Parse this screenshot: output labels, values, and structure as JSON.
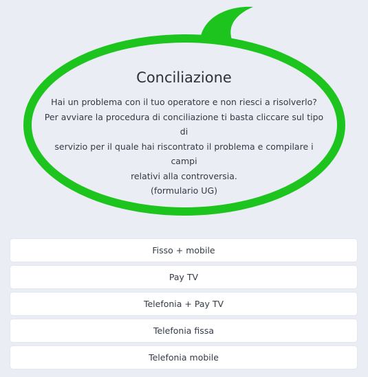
{
  "bubble": {
    "title": "Conciliazione",
    "lines": [
      "Hai un problema con il tuo operatore e non riesci a risolverlo?",
      "Per avviare la procedura di conciliazione ti basta cliccare sul tipo di",
      "servizio per il quale hai riscontrato il problema e compilare i campi",
      "relativi alla controversia.",
      "(formulario UG)"
    ],
    "color": "#1ec41e"
  },
  "options": [
    {
      "label": "Fisso + mobile"
    },
    {
      "label": "Pay TV"
    },
    {
      "label": "Telefonia + Pay TV"
    },
    {
      "label": "Telefonia fissa"
    },
    {
      "label": "Telefonia mobile"
    }
  ]
}
